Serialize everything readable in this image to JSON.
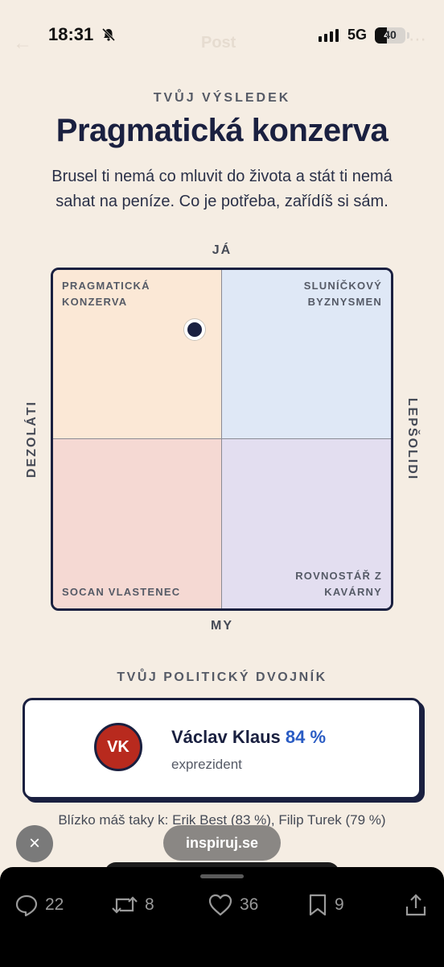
{
  "status_bar": {
    "time": "18:31",
    "network": "5G",
    "battery": "40",
    "battery_level_percent": 40
  },
  "header_faded": {
    "back": "←",
    "title": "Post",
    "more": "⋯"
  },
  "result": {
    "kicker": "TVŮJ VÝSLEDEK",
    "title": "Pragmatická konzerva",
    "description": "Brusel ti nemá co mluvit do života a stát ti nemá sahat na peníze. Co je potřeba, zařídíš si sám."
  },
  "compass": {
    "axis_top": "JÁ",
    "axis_bottom": "MY",
    "axis_left": "DEZOLÁTI",
    "axis_right": "LEPŠOLIDI",
    "quadrants": {
      "top_left": [
        "PRAGMATICKÁ",
        "KONZERVA"
      ],
      "top_right": [
        "SLUNÍČKOVÝ",
        "BYZNYSMEN"
      ],
      "bottom_left": [
        "SOCAN VLASTENEC"
      ],
      "bottom_right": [
        "ROVNOSTÁŘ Z",
        "KAVÁRNY"
      ]
    },
    "marker": {
      "x": -0.16,
      "y": 0.65
    },
    "colors": {
      "top_left": "#fbe8d6",
      "top_right": "#dfe8f6",
      "bottom_left": "#f5d9d3",
      "bottom_right": "#e3def0"
    }
  },
  "twin": {
    "kicker": "TVŮJ POLITICKÝ DVOJNÍK",
    "initials": "VK",
    "name": "Václav Klaus",
    "match": "84 %",
    "role": "exprezident",
    "also_close": "Blízko máš taky k: Erik Best (83 %), Filip Turek (79 %)"
  },
  "overlay": {
    "close_icon": "×",
    "url": "inspiruj.se"
  },
  "actions": {
    "replies": "22",
    "reposts": "8",
    "likes": "36",
    "bookmarks": "9"
  },
  "colors": {
    "accent": "#1a2040",
    "match": "#2a5cc4",
    "avatar": "#b82a1e",
    "background": "#f5ede3"
  }
}
